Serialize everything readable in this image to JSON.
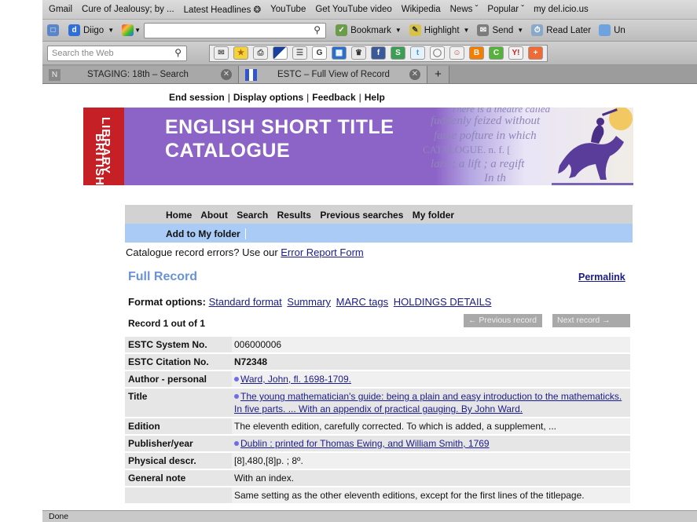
{
  "bookmarks": [
    {
      "label": "Gmail"
    },
    {
      "label": "Cure of Jealousy; by ..."
    },
    {
      "label": "Latest Headlines ❂"
    },
    {
      "label": "YouTube"
    },
    {
      "label": "Get YouTube video"
    },
    {
      "label": "Wikipedia"
    },
    {
      "label": "News ˇ"
    },
    {
      "label": "Popular ˇ"
    },
    {
      "label": "my del.icio.us"
    }
  ],
  "toolbar": {
    "diigo_label": "Diigo",
    "bookmark_label": "Bookmark",
    "highlight_label": "Highlight",
    "send_label": "Send",
    "read_later_label": "Read Later",
    "overflow_label": "Un"
  },
  "search_web": {
    "placeholder": "Search the Web"
  },
  "tabs": [
    {
      "label": "STAGING: 18th – Search",
      "favicon": "N"
    },
    {
      "label": "ESTC – Full View of Record"
    }
  ],
  "page": {
    "top_nav": [
      "End session",
      "Display options",
      "Feedback",
      "Help"
    ],
    "banner": {
      "library_line1": "BRITISH",
      "library_line2": "LIBRARY",
      "title_line1": "ENGLISH SHORT TITLE",
      "title_line2": "CATALOGUE",
      "parchment_lines": [
        "There is a theatre called",
        "fuddenly feized without",
        "fame pofture in which",
        "CATALOGUE. n. f. [",
        "lars ; a lift ; a regift",
        "In th"
      ]
    },
    "main_nav": [
      "Home",
      "About",
      "Search",
      "Results",
      "Previous searches",
      "My folder"
    ],
    "add_folder": "Add to My folder",
    "error_prefix": "Catalogue record errors? Use our ",
    "error_link": "Error Report Form",
    "heading": "Full Record",
    "permalink": "Permalink",
    "format_label": "Format options:",
    "formats": [
      "Standard format",
      "Summary",
      "MARC tags",
      "HOLDINGS DETAILS"
    ],
    "record_count": "Record 1 out of 1",
    "prev_record": "← Previous record",
    "next_record": "Next record        →",
    "fields": [
      {
        "label": "ESTC System No.",
        "value": "006000006"
      },
      {
        "label": "ESTC Citation No.",
        "value": "N72348"
      },
      {
        "label": "Author - personal",
        "value": "Ward, John, fl. 1698-1709."
      },
      {
        "label": "Title",
        "value": "The young mathematician's guide: being a plain and easy introduction to the mathematicks. In five parts. ... With an appendix of practical gauging. By John Ward."
      },
      {
        "label": "Edition",
        "value": "The eleventh edition, carefully corrected. To which is added, a supplement, ..."
      },
      {
        "label": "Publisher/year",
        "value": "Dublin : printed for Thomas Ewing, and William Smith, 1769"
      },
      {
        "label": "Physical descr.",
        "value": "[8],480,[8]p. ;  8º."
      },
      {
        "label": "General note",
        "value": "With an index."
      },
      {
        "label": "",
        "value": "Same setting as the other eleventh editions, except for the first lines of the titlepage."
      }
    ]
  },
  "status": "Done"
}
